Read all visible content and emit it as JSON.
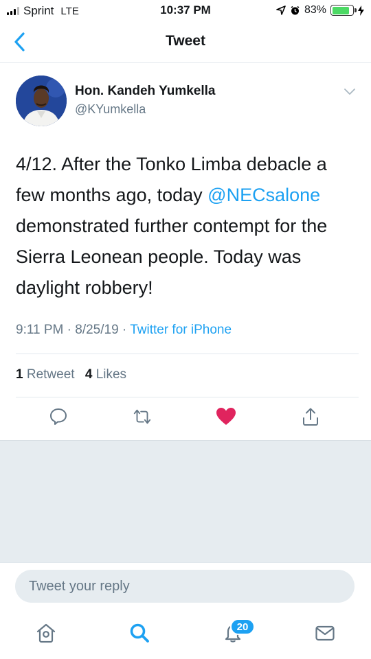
{
  "status_bar": {
    "carrier": "Sprint",
    "network": "LTE",
    "time": "10:37 PM",
    "battery_percent": "83%",
    "battery_level": 0.83
  },
  "nav": {
    "title": "Tweet"
  },
  "tweet": {
    "author_name": "Hon. Kandeh Yumkella",
    "author_handle": "@KYumkella",
    "text_part1": "4/12. After the Tonko Limba  debacle a few months ago, today ",
    "mention": "@NECsalone",
    "text_part2": " demonstrated further contempt for the Sierra Leonean people. Today was daylight robbery!",
    "time": "9:11 PM",
    "date": "8/25/19",
    "source": "Twitter for iPhone",
    "separator": " · ",
    "retweet_count": "1",
    "retweet_label": "Retweet",
    "like_count": "4",
    "like_label": "Likes"
  },
  "reply": {
    "placeholder": "Tweet your reply"
  },
  "tabbar": {
    "notifications_badge": "20"
  },
  "colors": {
    "accent": "#1da1f2",
    "like": "#e0245e",
    "secondary_text": "#657786"
  },
  "icons": {
    "back": "chevron-left-icon",
    "caret": "chevron-down-icon",
    "reply": "reply-icon",
    "retweet": "retweet-icon",
    "like": "heart-filled-icon",
    "share": "share-icon",
    "home": "home-icon",
    "search": "search-icon",
    "notifications": "bell-icon",
    "messages": "mail-icon"
  }
}
